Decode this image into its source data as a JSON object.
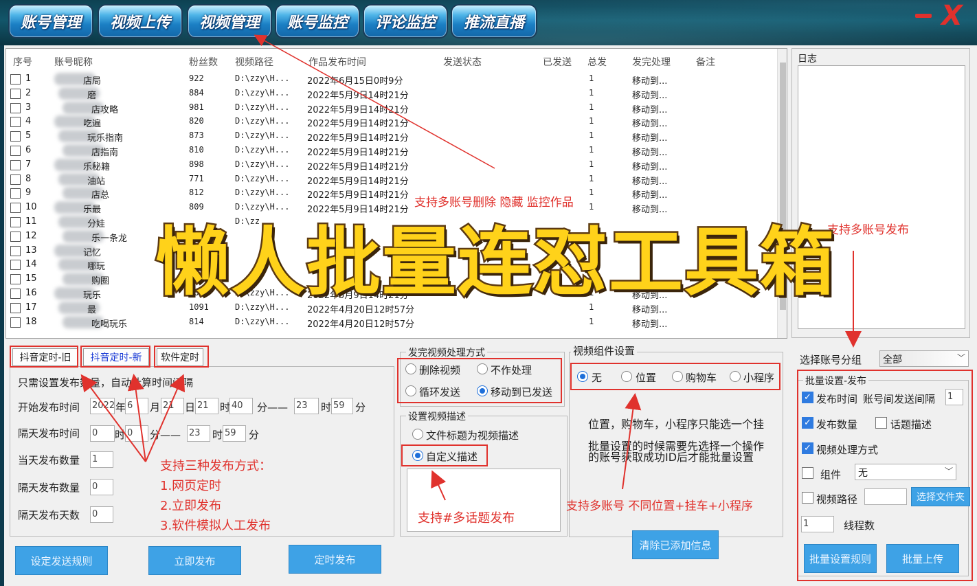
{
  "nav": [
    "账号管理",
    "视频上传",
    "视频管理",
    "账号监控",
    "评论监控",
    "推流直播"
  ],
  "window": {
    "minimize": "—",
    "close": "X"
  },
  "grid": {
    "headers": [
      "序号",
      "账号昵称",
      "粉丝数",
      "视频路径",
      "作品发布时间",
      "发送状态",
      "已发送",
      "总发",
      "发完处理",
      "备注"
    ],
    "rows": [
      {
        "n": "1",
        "name": "店局",
        "fans": "922",
        "path": "D:\\zzy\\H...",
        "time": "2022年6月15日0时9分",
        "total": "1",
        "after": "移动到..."
      },
      {
        "n": "2",
        "name": "磨",
        "fans": "884",
        "path": "D:\\zzy\\H...",
        "time": "2022年5月9日14时21分",
        "total": "1",
        "after": "移动到..."
      },
      {
        "n": "3",
        "name": "店攻略",
        "fans": "981",
        "path": "D:\\zzy\\H...",
        "time": "2022年5月9日14时21分",
        "total": "1",
        "after": "移动到..."
      },
      {
        "n": "4",
        "name": "吃遍",
        "fans": "820",
        "path": "D:\\zzy\\H...",
        "time": "2022年5月9日14时21分",
        "total": "1",
        "after": "移动到..."
      },
      {
        "n": "5",
        "name": "玩乐指南",
        "fans": "873",
        "path": "D:\\zzy\\H...",
        "time": "2022年5月9日14时21分",
        "total": "1",
        "after": "移动到..."
      },
      {
        "n": "6",
        "name": "店指南",
        "fans": "810",
        "path": "D:\\zzy\\H...",
        "time": "2022年5月9日14时21分",
        "total": "1",
        "after": "移动到..."
      },
      {
        "n": "7",
        "name": "乐秘籍",
        "fans": "898",
        "path": "D:\\zzy\\H...",
        "time": "2022年5月9日14时21分",
        "total": "1",
        "after": "移动到..."
      },
      {
        "n": "8",
        "name": "油站",
        "fans": "771",
        "path": "D:\\zzy\\H...",
        "time": "2022年5月9日14时21分",
        "total": "1",
        "after": "移动到..."
      },
      {
        "n": "9",
        "name": "店总",
        "fans": "812",
        "path": "D:\\zzy\\H...",
        "time": "2022年5月9日14时21分",
        "total": "1",
        "after": "移动到..."
      },
      {
        "n": "10",
        "name": "乐最",
        "fans": "809",
        "path": "D:\\zzy\\H...",
        "time": "2022年5月9日14时21分",
        "total": "1",
        "after": "移动到..."
      },
      {
        "n": "11",
        "name": "分娃",
        "fans": "",
        "path": "D:\\zz",
        "time": "",
        "total": "",
        "after": ""
      },
      {
        "n": "12",
        "name": "乐一条龙",
        "fans": "",
        "path": "",
        "time": "",
        "total": "",
        "after": ""
      },
      {
        "n": "13",
        "name": "记忆",
        "fans": "",
        "path": "",
        "time": "",
        "total": "",
        "after": ""
      },
      {
        "n": "14",
        "name": "哪玩",
        "fans": "",
        "path": "",
        "time": "",
        "total": "",
        "after": ""
      },
      {
        "n": "15",
        "name": "购圈",
        "fans": "",
        "path": "",
        "time": "",
        "total": "",
        "after": ""
      },
      {
        "n": "16",
        "name": "玩乐",
        "fans": "864",
        "path": "D:\\zzy\\H...",
        "time": "2022年5月9日14时21分",
        "total": "1",
        "after": "移动到..."
      },
      {
        "n": "17",
        "name": "最",
        "fans": "1091",
        "path": "D:\\zzy\\H...",
        "time": "2022年4月20日12时57分",
        "total": "1",
        "after": "移动到..."
      },
      {
        "n": "18",
        "name": "吃喝玩乐",
        "fans": "814",
        "path": "D:\\zzy\\H...",
        "time": "2022年4月20日12时57分",
        "total": "1",
        "after": "移动到..."
      }
    ]
  },
  "log": {
    "title": "日志"
  },
  "schedule": {
    "tabs": [
      "抖音定时-旧",
      "抖音定时-新",
      "软件定时"
    ],
    "hint": "只需设置发布数量，自动计算时间间隔",
    "start_label": "开始发布时间",
    "start": {
      "year": "2022",
      "y_unit": "年",
      "month": "6",
      "m_unit": "月",
      "day": "21",
      "d_unit": "日",
      "hour": "21",
      "h_unit": "时",
      "min": "40",
      "min_unit": "分——",
      "hour2": "23",
      "h2_unit": "时",
      "min2": "59",
      "min2_unit": "分"
    },
    "nextday_label": "隔天发布时间",
    "nextday": {
      "hour": "0",
      "h_unit": "时",
      "min": "0",
      "min_unit": "分——",
      "hour2": "23",
      "h2_unit": "时",
      "min2": "59",
      "min2_unit": "分"
    },
    "today_count_label": "当天发布数量",
    "today_count": "1",
    "next_count_label": "隔天发布数量",
    "next_count": "0",
    "next_days_label": "隔天发布天数",
    "next_days": "0"
  },
  "buttons": {
    "set_rule": "设定发送规则",
    "publish_now": "立即发布",
    "timed_publish": "定时发布",
    "clear_added": "清除已添加信息",
    "batch_rule": "批量设置规则",
    "batch_upload": "批量上传",
    "choose_folder": "选择文件夹"
  },
  "after_send": {
    "title": "发完视频处理方式",
    "options": [
      "删除视频",
      "不作处理",
      "循环发送",
      "移动到已发送"
    ],
    "selected": 3
  },
  "desc": {
    "title": "设置视频描述",
    "options": [
      "文件标题为视频描述",
      "自定义描述"
    ],
    "selected": 1
  },
  "component": {
    "title": "视频组件设置",
    "options": [
      "无",
      "位置",
      "购物车",
      "小程序"
    ],
    "selected": 0,
    "note1": "位置，购物车，小程序只能选一个挂",
    "note2": "批量设置的时候需要先选择一个操作",
    "note3": "的账号获取成功ID后才能批量设置"
  },
  "batch": {
    "group_label": "选择账号分组",
    "group_value": "全部",
    "title": "批量设置-发布",
    "publish_time": "发布时间",
    "interval_label": "账号间发送间隔",
    "interval": "1",
    "publish_count": "发布数量",
    "topic_desc": "话题描述",
    "process_mode": "视频处理方式",
    "component_label": "组件",
    "component_value": "无",
    "video_path": "视频路径",
    "threads_value": "1",
    "threads_label": "线程数"
  },
  "annotations": {
    "a1": "支持多账号删除 隐藏 监控作品",
    "a2": "支持多账号发布",
    "a3": "支持三种发布方式：",
    "a4": "1.网页定时",
    "a5": "2.立即发布",
    "a6": "3.软件模拟人工发布",
    "a7": "支持#多话题发布",
    "a8": "支持多账号  不同位置+挂车+小程序"
  },
  "overlay_title": "懒人批量连怼工具箱",
  "colors": {
    "accent": "#e0322d",
    "button": "#3ea2e6",
    "title_fill": "#ffd21a"
  }
}
